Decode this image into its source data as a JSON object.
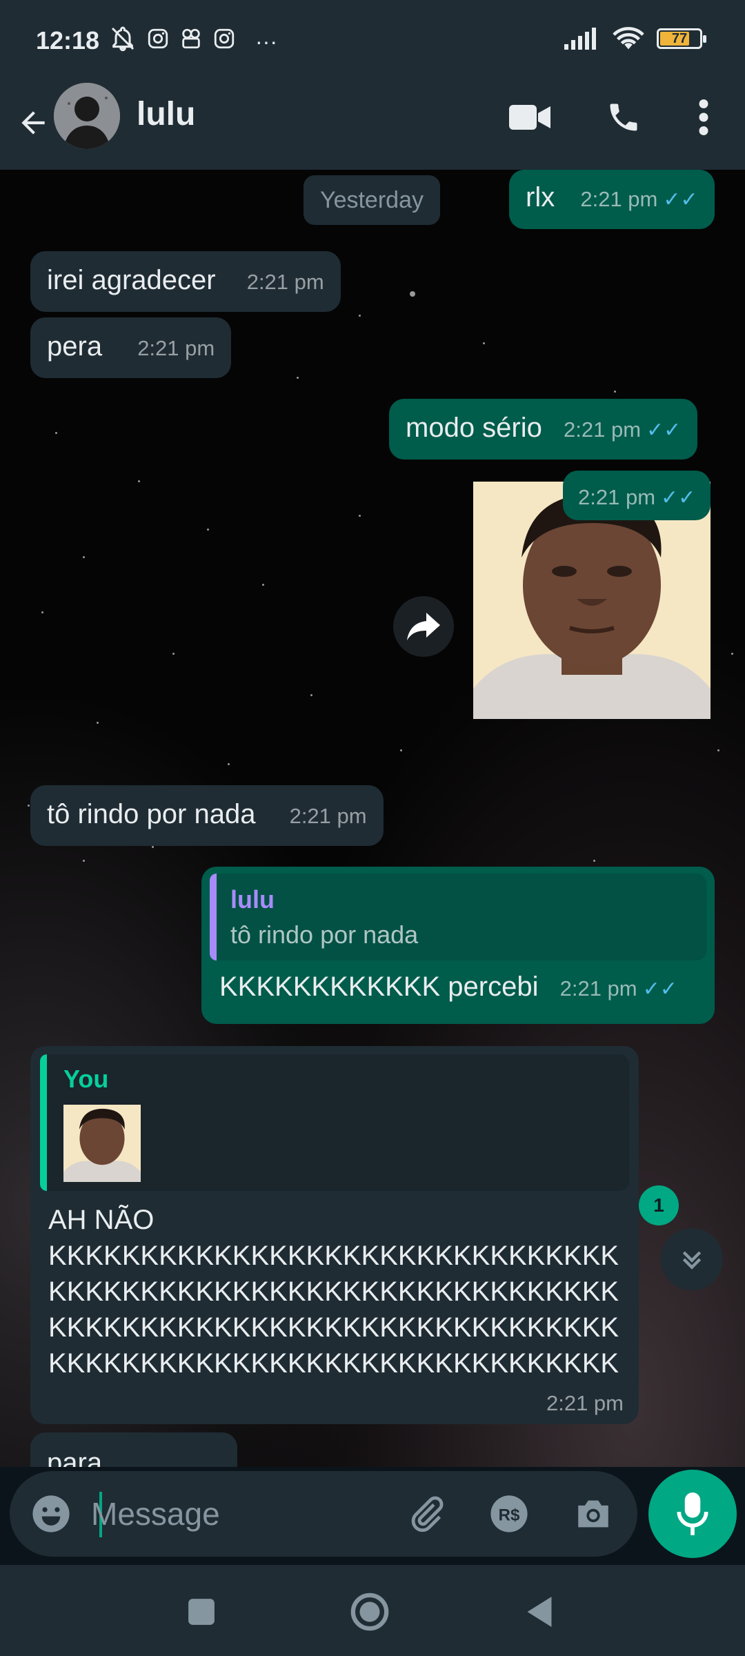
{
  "status_bar": {
    "time": "12:18",
    "battery": "77",
    "overflow": "···"
  },
  "header": {
    "contact_name": "lulu"
  },
  "chat": {
    "date_chip": "Yesterday",
    "messages": [
      {
        "dir": "out",
        "text": "rlx",
        "time": "2:21 pm"
      },
      {
        "dir": "in",
        "text": "irei agradecer",
        "time": "2:21 pm"
      },
      {
        "dir": "in",
        "text": "pera",
        "time": "2:21 pm"
      },
      {
        "dir": "out",
        "text": "modo sério",
        "time": "2:21 pm"
      },
      {
        "dir": "out",
        "type": "image",
        "time": "2:21 pm"
      },
      {
        "dir": "in",
        "text": "tô rindo por nada",
        "time": "2:21 pm"
      },
      {
        "dir": "out",
        "quote_author": "lulu",
        "quote_text": "tô rindo por nada",
        "text": "KKKKKKKKKKKK percebi",
        "time": "2:21 pm"
      },
      {
        "dir": "in",
        "quote_author": "You",
        "text_lines": [
          "AH NÃO",
          "KKKKKKKKKKKKKKKKKKKKKKKKKKKKKKK",
          "KKKKKKKKKKKKKKKKKKKKKKKKKKKKKKK",
          "KKKKKKKKKKKKKKKKKKKKKKKKKKKKKKK",
          "KKKKKKKKKKKKKKKKKKKKKKKKKKKKKKK"
        ],
        "time": "2:21 pm"
      },
      {
        "dir": "in",
        "text": "para"
      }
    ],
    "unread_count": "1"
  },
  "composer": {
    "placeholder": "Message",
    "value": ""
  },
  "icons": [
    "back-arrow-icon",
    "video-call-icon",
    "phone-icon",
    "more-vert-icon",
    "emoji-icon",
    "attach-icon",
    "payment-icon",
    "camera-icon",
    "mic-icon",
    "forward-icon",
    "double-check-icon",
    "chevron-double-down-icon"
  ],
  "colors": {
    "header_bg": "#1f2c34",
    "outgoing_bubble": "#005c4b",
    "incoming_bubble": "#1f2c34",
    "accent": "#00a884",
    "read_ticks": "#53bdeb"
  }
}
